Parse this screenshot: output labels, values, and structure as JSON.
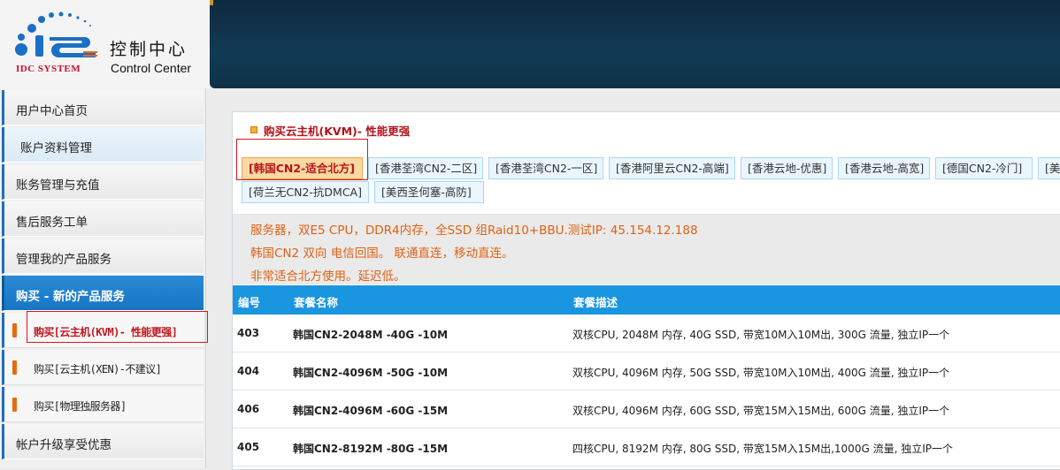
{
  "header": {
    "brand": "IDC SYSTEM",
    "title_cn": "控制中心",
    "title_en": "Control Center"
  },
  "sidebar": {
    "items": [
      {
        "label": "用户中心首页"
      },
      {
        "label": "账户资料管理"
      },
      {
        "label": "账务管理与充值"
      },
      {
        "label": "售后服务工单"
      },
      {
        "label": "管理我的产品服务"
      },
      {
        "label": "购买 - 新的产品服务"
      },
      {
        "label": "购买[云主机(KVM)- 性能更强]"
      },
      {
        "label": "购买[云主机(XEN)-不建议]"
      },
      {
        "label": "购买[物理独服务器]"
      },
      {
        "label": "帐户升级享受优惠"
      }
    ]
  },
  "panel": {
    "title": "购买云主机(KVM)- 性能更强",
    "tabs": [
      {
        "label": "[韩国CN2-适合北方]"
      },
      {
        "label": "[香港荃湾CN2-二区]"
      },
      {
        "label": "[香港荃湾CN2-一区]"
      },
      {
        "label": "[香港阿里云CN2-高端]"
      },
      {
        "label": "[香港云地-优惠]"
      },
      {
        "label": "[香港云地-高宽]"
      },
      {
        "label": "[德国CN2-冷门]"
      },
      {
        "label": "[美"
      },
      {
        "label": "[荷兰无CN2-抗DMCA]"
      },
      {
        "label": "[美西圣何塞-高防]"
      }
    ],
    "description": [
      "服务器，双E5 CPU，DDR4内存，全SSD 组Raid10+BBU.测试IP: 45.154.12.188",
      "韩国CN2 双向 电信回国。 联通直连，移动直连。",
      "非常适合北方使用。延迟低。"
    ],
    "table": {
      "headers": [
        "编号",
        "套餐名称",
        "套餐描述"
      ],
      "rows": [
        {
          "id": "403",
          "name": "韩国CN2-2048M -40G -10M",
          "desc": "双核CPU, 2048M 内存, 40G SSD, 带宽10M入10M出, 300G 流量, 独立IP一个"
        },
        {
          "id": "404",
          "name": "韩国CN2-4096M -50G -10M",
          "desc": "双核CPU, 4096M 内存, 50G SSD, 带宽10M入10M出, 400G 流量, 独立IP一个"
        },
        {
          "id": "406",
          "name": "韩国CN2-4096M -60G -15M",
          "desc": "双核CPU, 4096M 内存, 60G SSD, 带宽15M入15M出, 600G 流量, 独立IP一个"
        },
        {
          "id": "405",
          "name": "韩国CN2-8192M -80G -15M",
          "desc": "四核CPU, 8192M 内存, 80G SSD, 带宽15M入15M出,1000G 流量, 独立IP一个"
        }
      ]
    }
  },
  "colors": {
    "accent": "#1a95e0",
    "banner": "#123a55",
    "highlight": "#d8171c",
    "description_text": "#e06214"
  }
}
